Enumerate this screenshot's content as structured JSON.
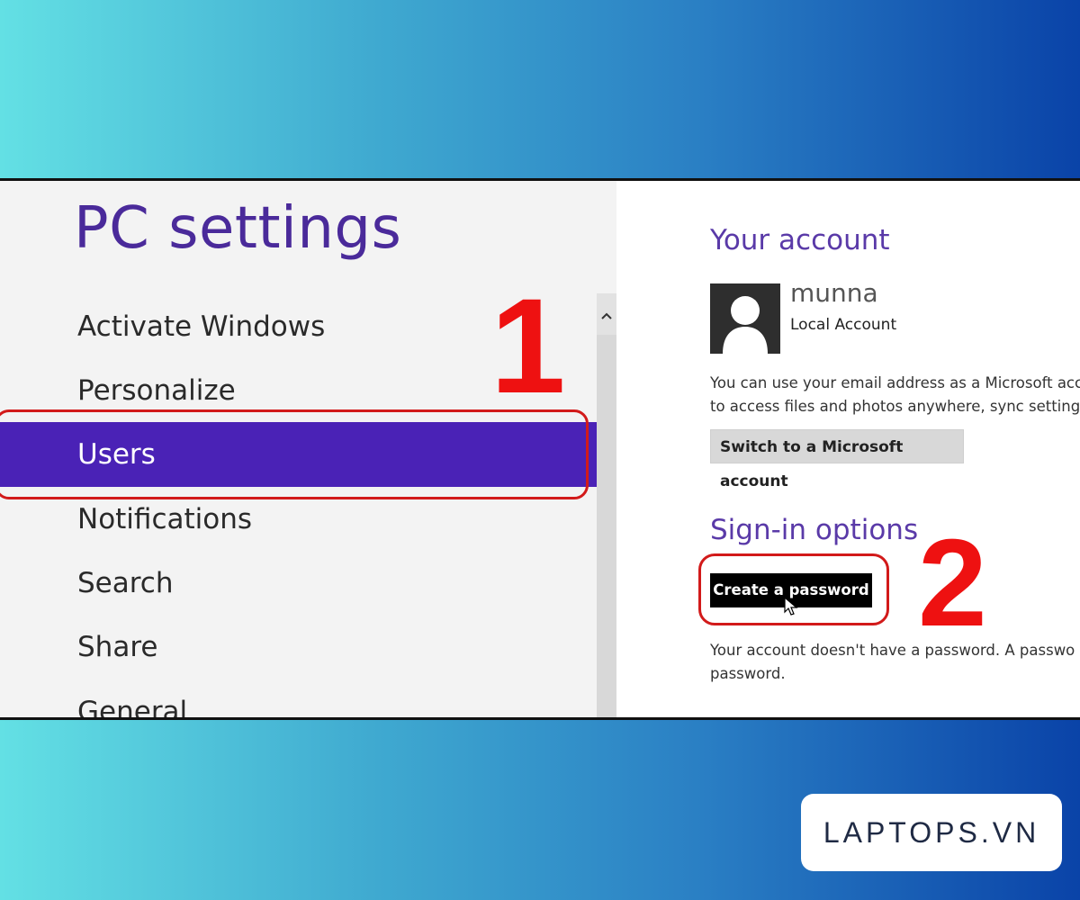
{
  "settings": {
    "title": "PC settings",
    "nav_items": [
      {
        "label": "Activate Windows"
      },
      {
        "label": "Personalize"
      },
      {
        "label": "Users",
        "selected": true
      },
      {
        "label": "Notifications"
      },
      {
        "label": "Search"
      },
      {
        "label": "Share"
      },
      {
        "label": "General"
      }
    ],
    "scroll_up_icon": "chevron-up-icon"
  },
  "account": {
    "section_title": "Your account",
    "username": "munna",
    "account_type": "Local Account",
    "info_line1": "You can use your email address as a Microsoft acc",
    "info_line2": "to access files and photos anywhere, sync settings",
    "switch_button": "Switch to a Microsoft account"
  },
  "signin": {
    "section_title": "Sign-in options",
    "create_button": "Create a password",
    "note_line1": "Your account doesn't have a password. A passwo",
    "note_line2": "password."
  },
  "annotations": {
    "step1": "1",
    "step2": "2",
    "color": "#ee1111"
  },
  "brand": {
    "logo_text": "LAPTOPS.VN"
  },
  "colors": {
    "accent_selected": "#4a22b6",
    "title_purple": "#4a2a9a"
  }
}
